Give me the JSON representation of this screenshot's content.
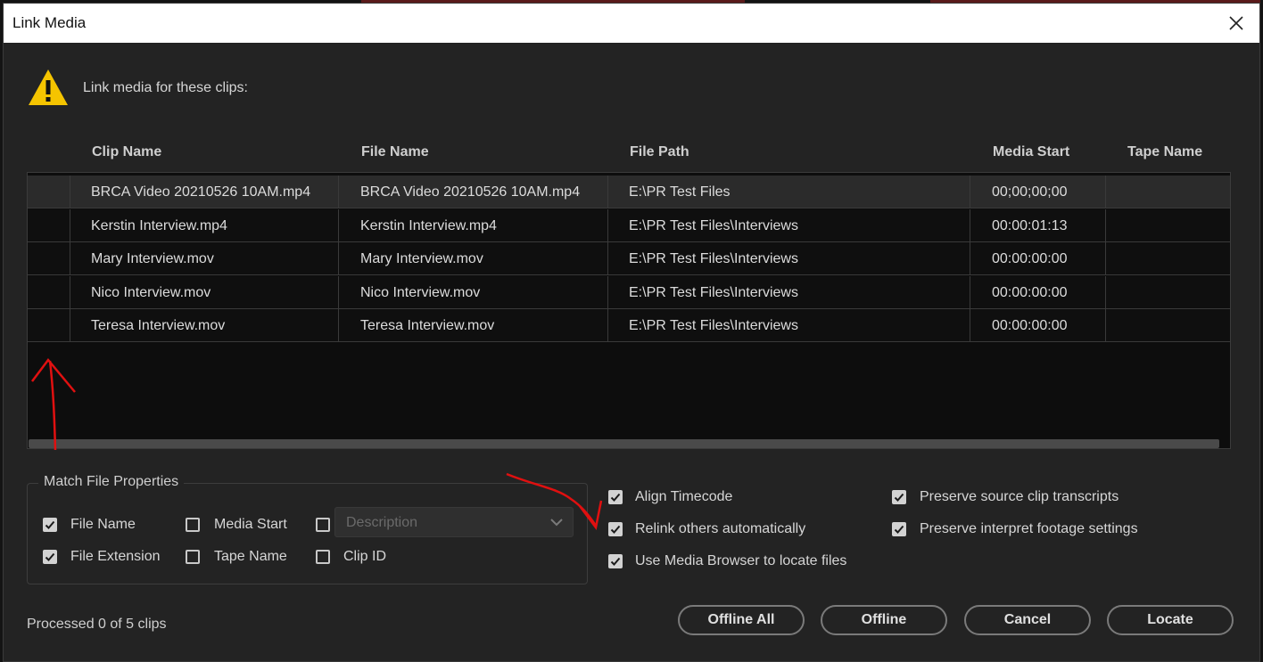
{
  "window": {
    "title": "Link Media"
  },
  "header": {
    "prompt": "Link media for these clips:"
  },
  "table": {
    "columns": [
      "Clip Name",
      "File Name",
      "File Path",
      "Media Start",
      "Tape Name"
    ],
    "rows": [
      {
        "clip": "BRCA Video 20210526 10AM.mp4",
        "file": "BRCA Video 20210526 10AM.mp4",
        "path": "E:\\PR Test Files",
        "start": "00;00;00;00",
        "tape": ""
      },
      {
        "clip": "Kerstin Interview.mp4",
        "file": "Kerstin Interview.mp4",
        "path": "E:\\PR Test Files\\Interviews",
        "start": "00:00:01:13",
        "tape": ""
      },
      {
        "clip": "Mary Interview.mov",
        "file": "Mary Interview.mov",
        "path": "E:\\PR Test Files\\Interviews",
        "start": "00:00:00:00",
        "tape": ""
      },
      {
        "clip": "Nico Interview.mov",
        "file": "Nico Interview.mov",
        "path": "E:\\PR Test Files\\Interviews",
        "start": "00:00:00:00",
        "tape": ""
      },
      {
        "clip": "Teresa Interview.mov",
        "file": "Teresa Interview.mov",
        "path": "E:\\PR Test Files\\Interviews",
        "start": "00:00:00:00",
        "tape": ""
      }
    ]
  },
  "match": {
    "title": "Match File Properties",
    "file_name": "File Name",
    "file_extension": "File Extension",
    "media_start": "Media Start",
    "tape_name": "Tape Name",
    "clip_id": "Clip ID",
    "description_placeholder": "Description"
  },
  "options": {
    "align_timecode": "Align Timecode",
    "relink_others": "Relink others automatically",
    "use_media_browser": "Use Media Browser to locate files",
    "preserve_transcripts": "Preserve source clip transcripts",
    "preserve_interpret": "Preserve interpret footage settings"
  },
  "status": "Processed 0 of 5 clips",
  "buttons": {
    "offline_all": "Offline All",
    "offline": "Offline",
    "cancel": "Cancel",
    "locate": "Locate"
  },
  "colors": {
    "dialog_bg": "#232323",
    "warning": "#f5c400",
    "annotation": "#e01010"
  }
}
